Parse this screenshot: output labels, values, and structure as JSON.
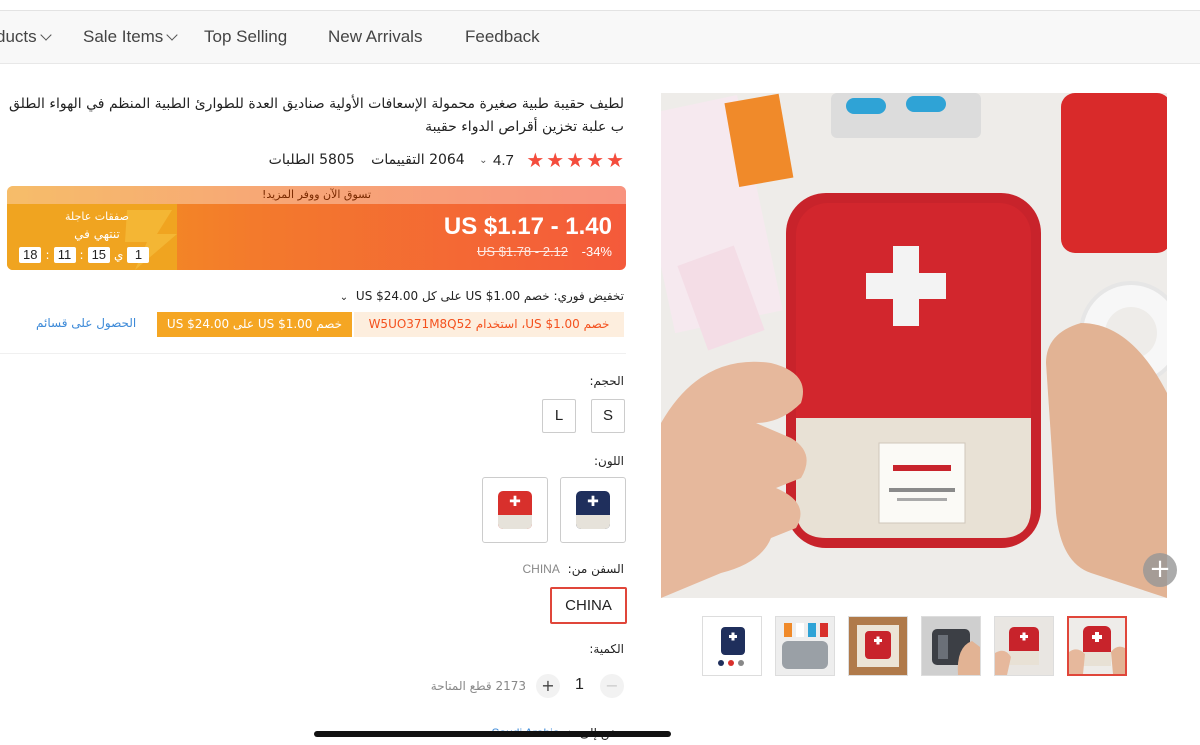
{
  "nav": {
    "items": [
      {
        "label": "ducts",
        "has_dropdown": true
      },
      {
        "label": "Sale Items",
        "has_dropdown": true
      },
      {
        "label": "Top Selling",
        "has_dropdown": false
      },
      {
        "label": "New Arrivals",
        "has_dropdown": false
      },
      {
        "label": "Feedback",
        "has_dropdown": false
      }
    ]
  },
  "product": {
    "title_line1": "لطيف حقيبة طبية صغيرة محمولة الإسعافات الأولية صناديق العدة للطوارئ الطبية المنظم في الهواء الطلق المنزلية الط",
    "title_line2": "ب علبة تخزين أقراص الدواء حقيبة",
    "rating_value": "4.7",
    "reviews": "2064 التقييمات",
    "orders": "5805 الطلبات"
  },
  "price_banner": {
    "top_text": "تسوق الآن ووفر المزيد!",
    "price": "US $1.17 - 1.40",
    "original_price": "US $1.78 - 2.12",
    "discount": "-34%",
    "flash_title": "صفقات عاجلة",
    "flash_subtitle": "تنتهي في",
    "timer": {
      "days": "1",
      "day_unit": "ي",
      "hours": "15",
      "minutes": "11",
      "seconds": "18"
    }
  },
  "coupon": {
    "instant_text": "تخفيض فوري: خصم US $1.00 على كل US $24.00",
    "code_text": "خصم US $1.00، استخدام W5UO371M8Q52",
    "ticket_text": "خصم US $1.00 على US $24.00",
    "get_more": "الحصول على قسائم"
  },
  "options": {
    "size_label": "الحجم:",
    "sizes": [
      "S",
      "L"
    ],
    "color_label": "اللون:",
    "colors": [
      {
        "name": "navy",
        "hex": "#1f2f5c"
      },
      {
        "name": "red",
        "hex": "#d8302c"
      }
    ],
    "ship_label": "السفن من:",
    "ship_value": "CHINA",
    "ship_button": "CHINA",
    "qty_label": "الكمية:",
    "quantity": "1",
    "available": "2173 قطع المتاحة",
    "deliver_to_label": "سفن إلى",
    "deliver_to_country": "Saudi Arabia"
  },
  "gallery": {
    "main_image": "red-first-aid-pouch-held-in-hands",
    "zoom_icon": "plus-circle-icon",
    "thumbnails": [
      "navy-pouch",
      "open-pouch-contents",
      "red-pouch-in-box",
      "hand-opening-pouch",
      "red-pouch-table",
      "red-pouch-in-hands"
    ],
    "selected_index": 5
  },
  "colors": {
    "accent_red": "#e0463a",
    "banner_orange": "#f37a2c",
    "link_blue": "#3d8ad8",
    "coupon_gold": "#f5a623",
    "star": "#f44c3c"
  }
}
